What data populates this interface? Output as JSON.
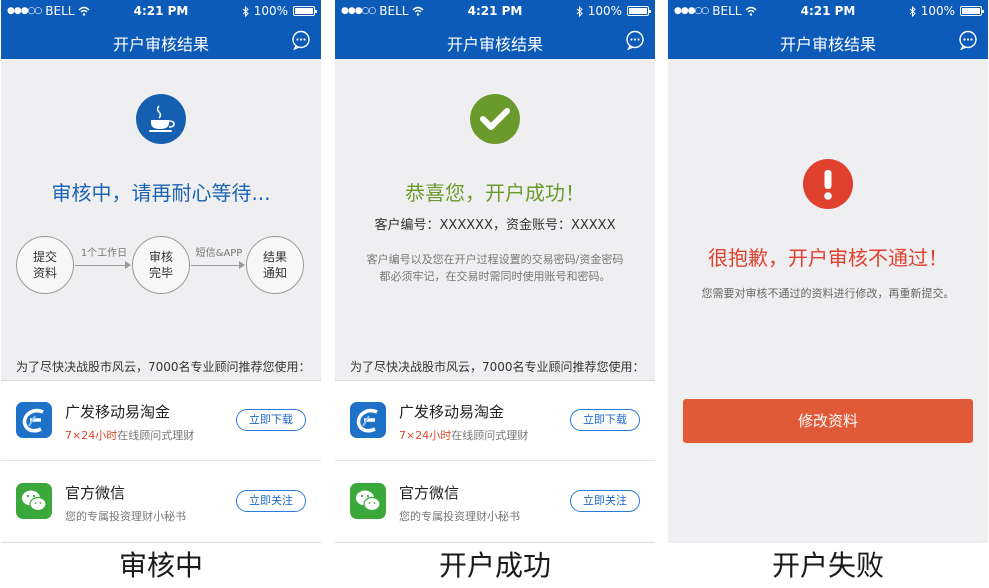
{
  "statusbar": {
    "carrier": "BELL",
    "time": "4:21 PM",
    "battery": "100%"
  },
  "navbar": {
    "title": "开户审核结果"
  },
  "screens": [
    {
      "headline": "审核中，请再耐心等待...",
      "steps": [
        {
          "label": "提交资料"
        },
        {
          "label": "审核完毕"
        },
        {
          "label": "结果通知"
        }
      ],
      "arrows": [
        "1个工作日",
        "短信&APP"
      ],
      "caption": "审核中"
    },
    {
      "headline": "恭喜您，开户成功！",
      "customer_info": "客户编号：XXXXXX，资金账号：XXXXX",
      "notice_line1": "客户编号以及您在开户过程设置的交易密码/资金密码",
      "notice_line2": "都必须牢记，在交易时需同时使用账号和密码。",
      "caption": "开户成功"
    },
    {
      "headline": "很抱歉，开户审核不通过！",
      "notice": "您需要对审核不通过的资料进行修改，再重新提交。",
      "button_label": "修改资料",
      "caption": "开户失败"
    }
  ],
  "recommend_text": "为了尽快决战股市风云，7000名专业顾问推荐您使用：",
  "apps": [
    {
      "name": "广发移动易淘金",
      "desc_highlight": "7×24小时",
      "desc_rest": "在线顾问式理财",
      "button": "立即下载"
    },
    {
      "name": "官方微信",
      "desc_highlight": "",
      "desc_rest": "您的专属投资理财小秘书",
      "button": "立即关注"
    }
  ],
  "icons": {
    "waiting": "coffee-cup-icon",
    "success": "checkmark-icon",
    "failure": "exclamation-icon",
    "chat": "chat-bubble-icon",
    "app1": "gf-logo-icon",
    "app2": "wechat-icon"
  },
  "colors": {
    "nav_blue": "#0d5bb8",
    "waiting_blue": "#1c64b4",
    "success_green": "#6a9a2c",
    "failure_red": "#e0412f",
    "button_orange": "#e05a38"
  }
}
